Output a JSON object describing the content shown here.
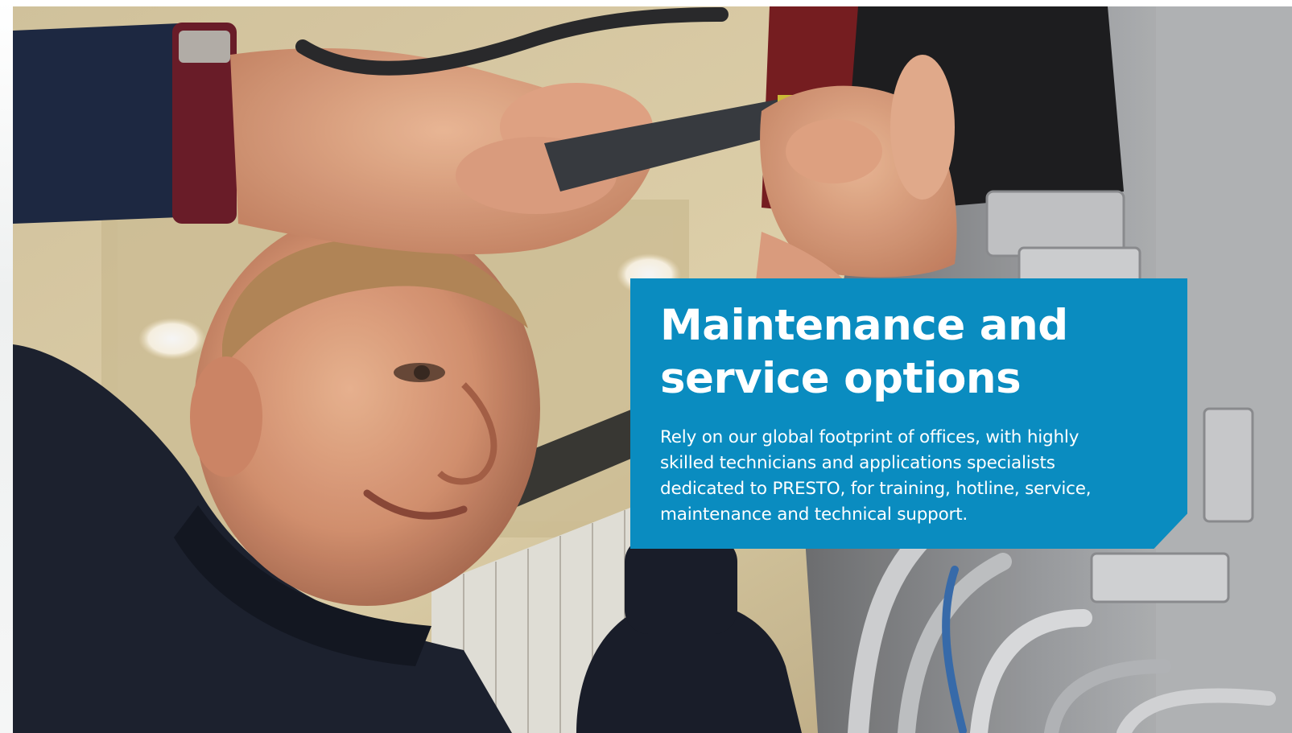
{
  "panel": {
    "title_line1": "Maintenance and",
    "title_line2": "service options",
    "body_line1": "Rely on our global footprint of offices, with highly",
    "body_line2": "skilled technicians and applications specialists",
    "body_line3": "dedicated to PRESTO, for training, hotline, service,",
    "body_line4": "maintenance and technical support.",
    "background_color": "#0a8cc0",
    "text_color": "#ffffff"
  },
  "photo": {
    "subject": "technician-servicing-equipment"
  }
}
